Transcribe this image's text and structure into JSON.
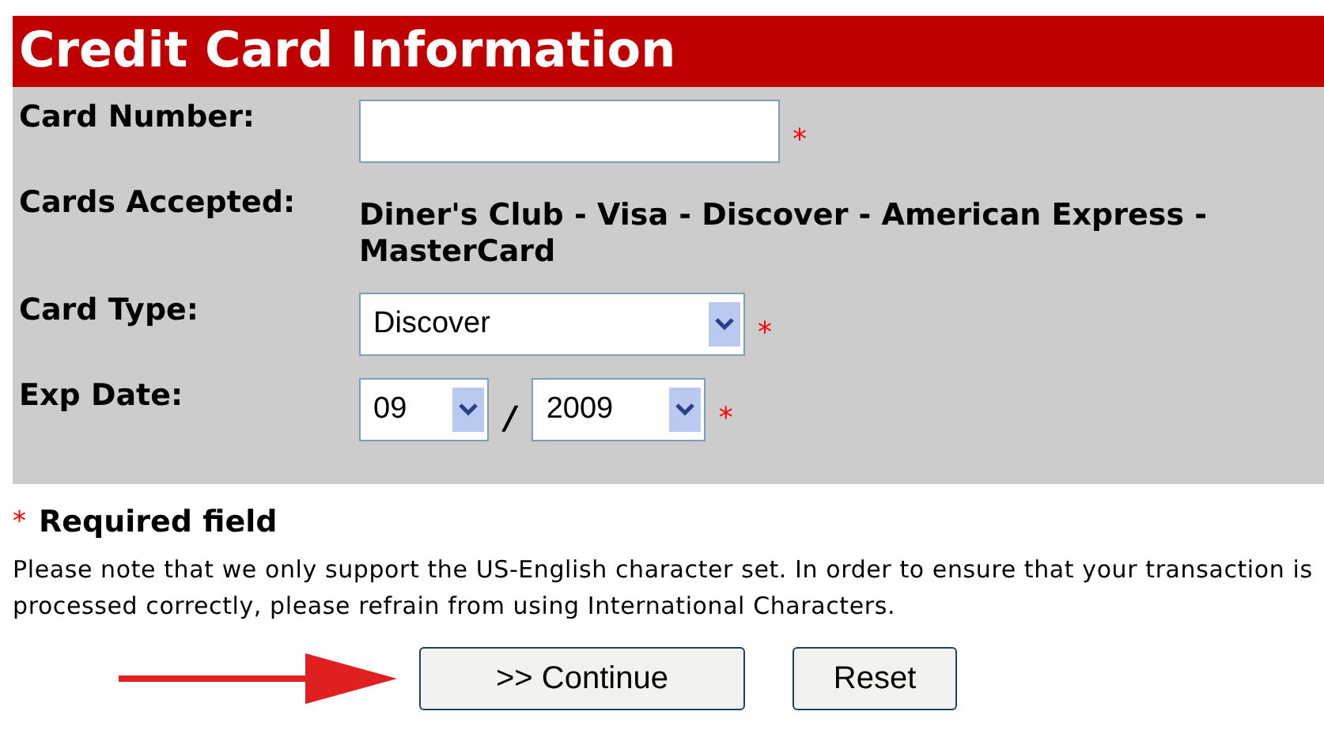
{
  "title": "Credit Card Information",
  "fields": [
    {
      "kind": "input",
      "label": "Card Number:",
      "required_mark": "*"
    },
    {
      "kind": "text",
      "label": "Cards Accepted:",
      "value": "Diner's Club - Visa - Discover - American Express - MasterCard"
    },
    {
      "kind": "select",
      "label": "Card Type:",
      "value": "Discover",
      "required_mark": "*"
    },
    {
      "kind": "date",
      "label": "Exp Date:",
      "month": "09",
      "separator": "/",
      "year": "2009",
      "required_mark": "*"
    }
  ],
  "required_note": {
    "mark": "*",
    "text": "Required field"
  },
  "notice": "Please note that we only support the US-English character set. In order to ensure that your transaction is processed correctly, please refrain from using International Characters.",
  "buttons": [
    ">> Continue",
    "Reset"
  ]
}
